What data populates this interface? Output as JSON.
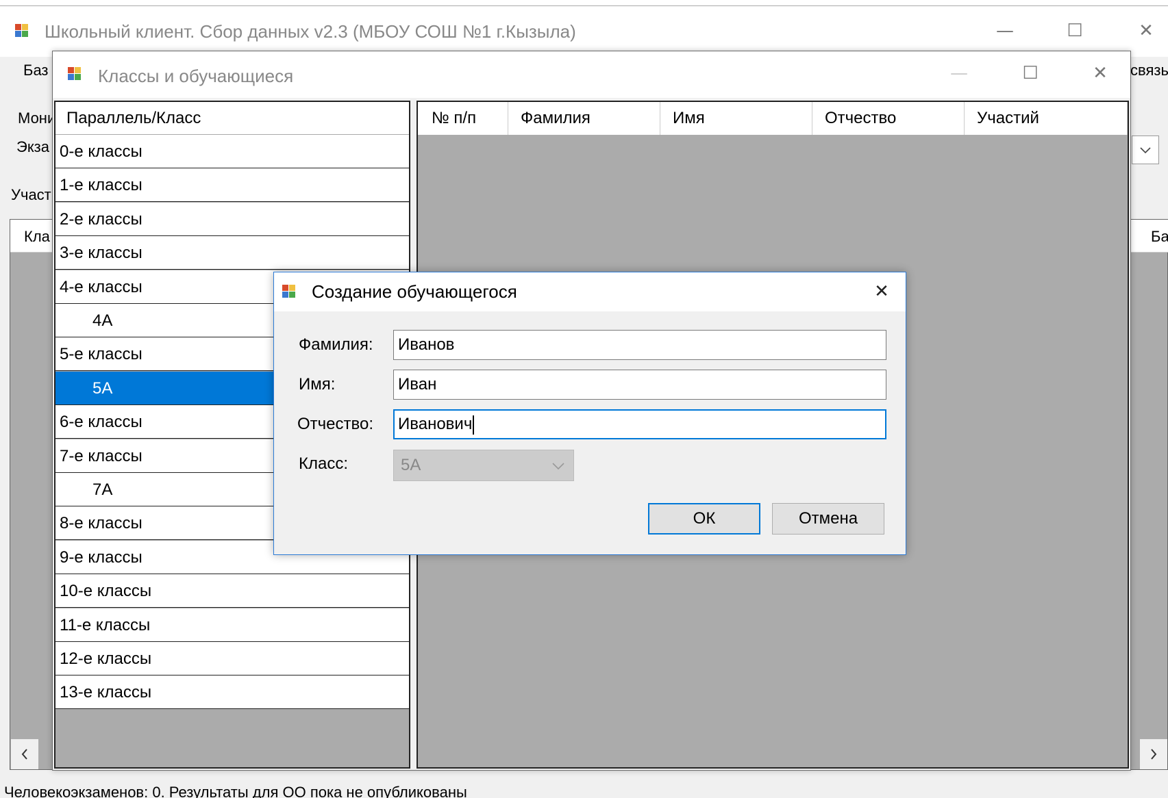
{
  "main_window": {
    "title": "Школьный клиент. Сбор данных v2.3 (МБОУ СОШ №1 г.Кызыла)",
    "menu_left": "Баз",
    "menu_right": "связь",
    "label_moni": "Мони",
    "label_ekza": "Экза",
    "label_uchast": "Участ",
    "grid_col_left": "Кла",
    "grid_col_right": "Ба",
    "status_text": "Человекоэкзаменов: 0. Результаты для ОО пока не опубликованы"
  },
  "classes_window": {
    "title": "Классы и обучающиеся",
    "tree_header": "Параллель/Класс",
    "tree_rows": [
      {
        "label": "0-е классы",
        "level": 0,
        "selected": false
      },
      {
        "label": "1-е классы",
        "level": 0,
        "selected": false
      },
      {
        "label": "2-е классы",
        "level": 0,
        "selected": false
      },
      {
        "label": "3-е классы",
        "level": 0,
        "selected": false
      },
      {
        "label": "4-е классы",
        "level": 0,
        "selected": false
      },
      {
        "label": "4А",
        "level": 1,
        "selected": false
      },
      {
        "label": "5-е классы",
        "level": 0,
        "selected": false
      },
      {
        "label": "5А",
        "level": 1,
        "selected": true
      },
      {
        "label": "6-е классы",
        "level": 0,
        "selected": false
      },
      {
        "label": "7-е классы",
        "level": 0,
        "selected": false
      },
      {
        "label": "7А",
        "level": 1,
        "selected": false
      },
      {
        "label": "8-е классы",
        "level": 0,
        "selected": false
      },
      {
        "label": "9-е классы",
        "level": 0,
        "selected": false
      },
      {
        "label": "10-е классы",
        "level": 0,
        "selected": false
      },
      {
        "label": "11-е классы",
        "level": 0,
        "selected": false
      },
      {
        "label": "12-е классы",
        "level": 0,
        "selected": false
      },
      {
        "label": "13-е классы",
        "level": 0,
        "selected": false
      }
    ],
    "grid_columns": [
      "№ п/п",
      "Фамилия",
      "Имя",
      "Отчество",
      "Участий"
    ]
  },
  "dialog": {
    "title": "Создание обучающегося",
    "surname_label": "Фамилия:",
    "surname_value": "Иванов",
    "name_label": "Имя:",
    "name_value": "Иван",
    "patronymic_label": "Отчество:",
    "patronymic_value": "Иванович",
    "class_label": "Класс:",
    "class_value": "5А",
    "ok_label": "ОК",
    "cancel_label": "Отмена"
  },
  "icons": {
    "app": "app-icon",
    "minimize": "minimize-icon",
    "maximize": "maximize-icon",
    "close": "close-icon",
    "dropdown": "chevron-down-icon",
    "scroll_left": "scroll-left-icon",
    "scroll_right": "scroll-right-icon"
  },
  "colors": {
    "selection": "#0078d7",
    "grid_background": "#ababab",
    "window_background": "#f0f0f0",
    "dialog_border": "#2b7ad6"
  }
}
